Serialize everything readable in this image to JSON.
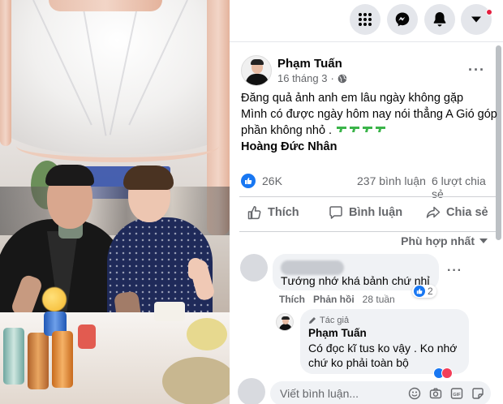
{
  "post": {
    "author": "Phạm Tuấn",
    "date": "16 tháng 3",
    "separator": "·",
    "text_lines": [
      "Đăng quả ảnh anh em lâu ngày không gặp",
      "Mình có được ngày hôm nay nói thẳng A Gió góp",
      "phần không nhỏ ."
    ],
    "tag": "Hoàng Đức Nhân",
    "likes": "26K",
    "comments": "237 bình luận",
    "shares": "6 lượt chia sẻ"
  },
  "actions": {
    "like": "Thích",
    "comment": "Bình luận",
    "share": "Chia sẻ"
  },
  "sort_label": "Phù hợp nhất",
  "comment1": {
    "text": "Tướng nhớ khá bảnh chứ nhỉ",
    "reactions": "2",
    "like": "Thích",
    "reply": "Phản hồi",
    "time": "28 tuần"
  },
  "reply1": {
    "badge": "Tác giả",
    "author": "Phạm Tuấn",
    "line1": "Có đọc kĩ tus ko vậy . Ko nhớ",
    "line2": "chứ ko phải toàn bộ"
  },
  "composer": {
    "placeholder": "Viết bình luận..."
  },
  "colors": {
    "accent": "#1877f2",
    "secondary_text": "#65676b",
    "bubble": "#f0f2f5",
    "notification": "#e41e3f"
  },
  "icons": [
    "menu-grid-icon",
    "messenger-icon",
    "bell-icon",
    "caret-down-icon",
    "globe-icon",
    "like-icon",
    "comment-icon",
    "share-icon",
    "pencil-icon",
    "smiley-icon",
    "camera-icon",
    "gif-icon",
    "sticker-icon"
  ]
}
